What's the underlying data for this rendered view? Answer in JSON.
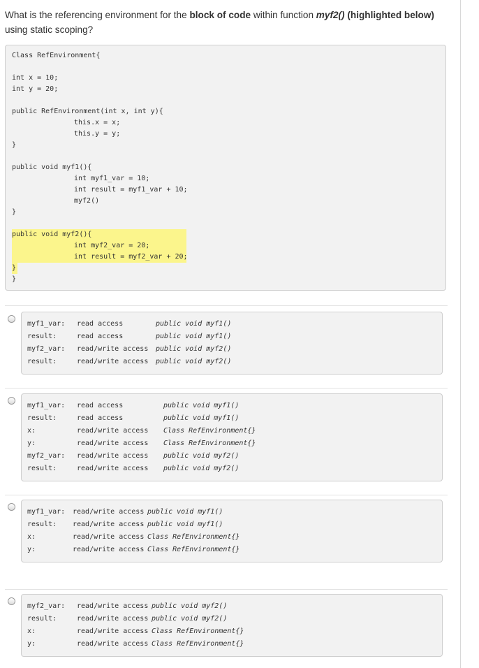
{
  "question": {
    "part1": "What is the referencing environment for the ",
    "part2": "block of code",
    "part3": " within function ",
    "part4": "myf2()",
    "part5": " (highlighted below)",
    "part6": " using static scoping?"
  },
  "code_lines": [
    "Class RefEnvironment{",
    "",
    "int x = 10;",
    "int y = 20;",
    "",
    "public RefEnvironment(int x, int y){",
    "this.x = x;",
    "this.y = y;",
    "}",
    "",
    "public void myf1(){",
    "int myf1_var = 10;",
    "int result = myf1_var + 10;",
    "myf2()",
    "",
    "}",
    "",
    "public void myf2(){",
    "int myf2_var = 20;",
    "int result = myf2_var + 20;",
    "}",
    "}"
  ],
  "options": [
    {
      "rows": [
        {
          "name": "myf1_var:",
          "access": "read access",
          "scope": "public void myf1()"
        },
        {
          "name": "result:",
          "access": "read access",
          "scope": "public void myf1()"
        },
        {
          "name": "myf2_var:",
          "access": "read/write access",
          "scope": "public void myf2()"
        },
        {
          "name": "result:",
          "access": "read/write access",
          "scope": "public void myf2()"
        }
      ]
    },
    {
      "rows": [
        {
          "name": "myf1_var:",
          "access": "read access",
          "scope": "public void myf1()"
        },
        {
          "name": "result:",
          "access": "read access",
          "scope": "public void myf1()"
        },
        {
          "name": "x:",
          "access": "read/write access",
          "scope": "Class RefEnvironment{}"
        },
        {
          "name": "y:",
          "access": "read/write access",
          "scope": "Class RefEnvironment{}"
        },
        {
          "name": "myf2_var:",
          "access": "read/write access",
          "scope": "public void myf2()"
        },
        {
          "name": "result:",
          "access": "read/write access",
          "scope": "public void myf2()"
        }
      ]
    },
    {
      "rows": [
        {
          "name": "myf1_var:",
          "access": "read/write access",
          "scope": "public void myf1()"
        },
        {
          "name": "result:",
          "access": "read/write access",
          "scope": "public void myf1()"
        },
        {
          "name": "x:",
          "access": "read/write access",
          "scope": "Class RefEnvironment{}"
        },
        {
          "name": "y:",
          "access": "read/write access",
          "scope": "Class RefEnvironment{}"
        }
      ]
    },
    {
      "rows": [
        {
          "name": "myf2_var:",
          "access": "read/write access",
          "scope": "public void myf2()"
        },
        {
          "name": "result:",
          "access": "read/write access",
          "scope": "public void myf2()"
        },
        {
          "name": "x:",
          "access": "read/write access",
          "scope": "Class RefEnvironment{}"
        },
        {
          "name": "y:",
          "access": "read/write access",
          "scope": "Class RefEnvironment{}"
        }
      ]
    }
  ],
  "colors": {
    "highlight": "#fbf58c",
    "panel": "#f2f2f2"
  }
}
